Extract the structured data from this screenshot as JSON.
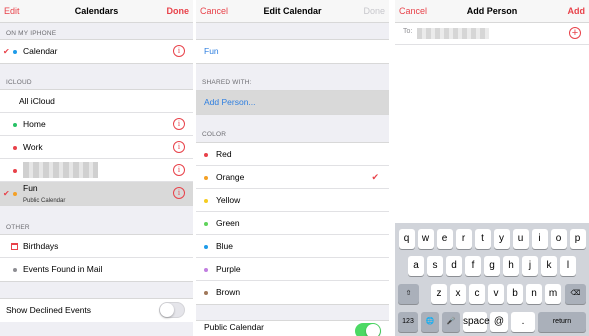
{
  "s1": {
    "nav": {
      "left": "Edit",
      "title": "Calendars",
      "right": "Done"
    },
    "sec_phone": "ON MY IPHONE",
    "sec_icloud": "ICLOUD",
    "sec_other": "OTHER",
    "phone_items": [
      {
        "label": "Calendar",
        "color": "#1e9be9",
        "checked": true
      }
    ],
    "all_icloud": "All iCloud",
    "icloud_items": [
      {
        "label": "Home",
        "color": "#27c166"
      },
      {
        "label": "Work",
        "color": "#e8424a"
      },
      {
        "label": "",
        "color": "#e8424a"
      },
      {
        "label": "Fun",
        "sub": "Public Calendar",
        "color": "#f4a025",
        "checked": true
      }
    ],
    "other_items": [
      {
        "label": "Birthdays",
        "icon": "calendar-grid-icon"
      },
      {
        "label": "Events Found in Mail",
        "color": "#8e8e93"
      }
    ],
    "declined": "Show Declined Events"
  },
  "s2": {
    "nav": {
      "left": "Cancel",
      "title": "Edit Calendar",
      "right": "Done"
    },
    "name": "Fun",
    "sec_shared": "SHARED WITH:",
    "add_person": "Add Person...",
    "sec_color": "COLOR",
    "colors": [
      {
        "label": "Red",
        "color": "#e8424a"
      },
      {
        "label": "Orange",
        "color": "#f4a025",
        "checked": true
      },
      {
        "label": "Yellow",
        "color": "#f5cc21"
      },
      {
        "label": "Green",
        "color": "#5fd35b"
      },
      {
        "label": "Blue",
        "color": "#1e9be9"
      },
      {
        "label": "Purple",
        "color": "#c17ee0"
      },
      {
        "label": "Brown",
        "color": "#a0785a"
      }
    ],
    "public": "Public Calendar"
  },
  "s3": {
    "nav": {
      "left": "Cancel",
      "title": "Add Person",
      "right": "Add"
    },
    "to": "To:",
    "rows": [
      [
        "q",
        "w",
        "e",
        "r",
        "t",
        "y",
        "u",
        "i",
        "o",
        "p"
      ],
      [
        "a",
        "s",
        "d",
        "f",
        "g",
        "h",
        "j",
        "k",
        "l"
      ],
      [
        "z",
        "x",
        "c",
        "v",
        "b",
        "n",
        "m"
      ]
    ],
    "k123": "123",
    "space": "space",
    "at": "@",
    "dot": ".",
    "ret": "return"
  }
}
